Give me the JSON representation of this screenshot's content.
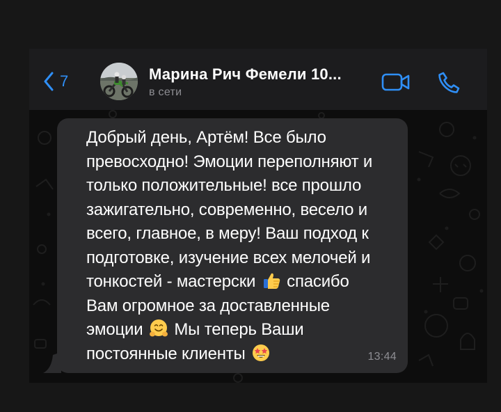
{
  "header": {
    "back_count": "7",
    "contact_name": "Марина Рич Фемели 10...",
    "status": "в сети"
  },
  "icons": {
    "back": "chevron-left-icon",
    "video": "video-camera-icon",
    "call": "phone-icon"
  },
  "colors": {
    "accent": "#2f8ff7",
    "bubble": "#2c2c2e",
    "chat_background": "#0d0d0d"
  },
  "message": {
    "line1": "Добрый день, Артём! Все было",
    "line2": "превосходно! Эмоции переполняют и",
    "line3": "только положительные! все прошло",
    "line4": "зажигательно, современно, весело и",
    "line5": "всего, главное, в меру! Ваш подход к",
    "line6": "подготовке, изучение всех мелочей и",
    "line7a": "тонкостей - мастерски",
    "line7b": "спасибо",
    "line8": "Вам огромное за доставленные",
    "line9a": "эмоции",
    "line9b": "Мы теперь Ваши",
    "line10": "постоянные клиенты",
    "time": "13:44",
    "emoji": [
      "thumbs-up-emoji",
      "hugging-face-emoji",
      "star-struck-emoji"
    ]
  }
}
